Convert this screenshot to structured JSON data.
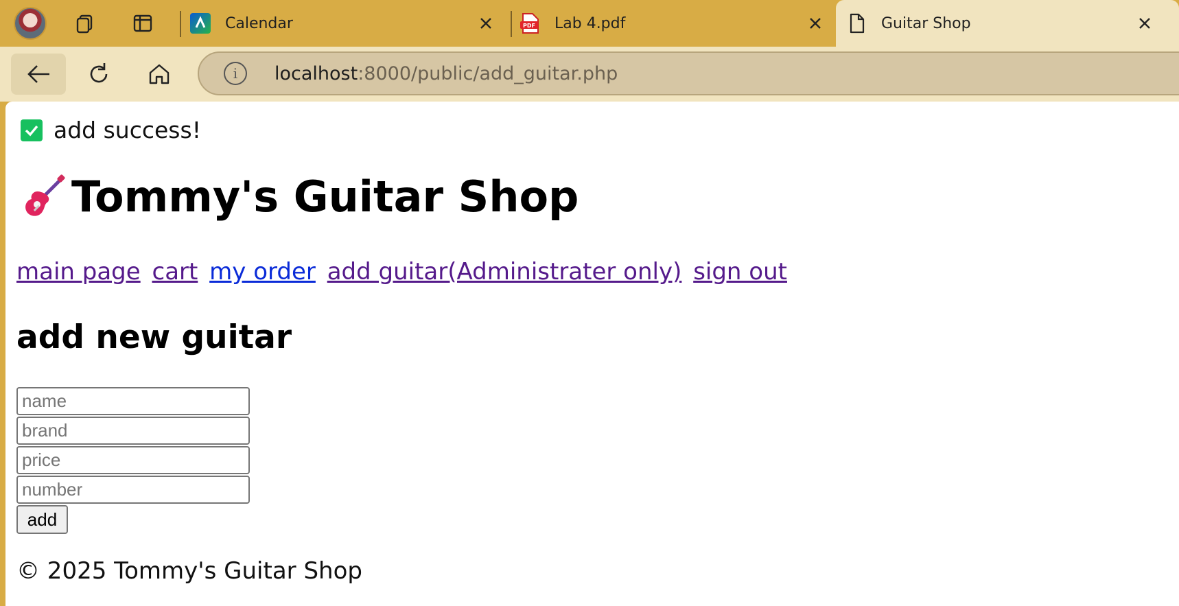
{
  "browser": {
    "tabs": [
      {
        "label": "Calendar",
        "favicon": "calendar-favicon"
      },
      {
        "label": "Lab 4.pdf",
        "favicon": "pdf-favicon"
      },
      {
        "label": "Guitar Shop",
        "favicon": "document-favicon",
        "active": true
      }
    ],
    "url": {
      "host": "localhost",
      "rest": ":8000/public/add_guitar.php"
    },
    "colors": {
      "frame": "#d8ac45",
      "toolbar": "#f1e4bf",
      "omnibox": "#d6c6a4"
    }
  },
  "page": {
    "flash_message": "add success!",
    "site_title": "Tommy's Guitar Shop",
    "nav": {
      "main_page": "main page",
      "cart": "cart",
      "my_order": "my order",
      "add_guitar": "add guitar(Administrater only)",
      "sign_out": "sign out"
    },
    "section_title": "add new guitar",
    "form": {
      "name_placeholder": "name",
      "brand_placeholder": "brand",
      "price_placeholder": "price",
      "number_placeholder": "number",
      "submit_label": "add"
    },
    "footer": "© 2025 Tommy's Guitar Shop",
    "colors": {
      "success": "#17c05f",
      "visited_link": "#551a8b",
      "link": "#0a2bd8"
    }
  }
}
